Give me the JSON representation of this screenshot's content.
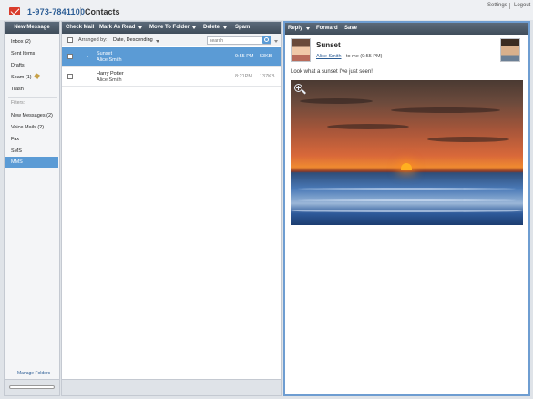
{
  "header": {
    "phone": "1-973-7841100",
    "contacts_label": "Contacts",
    "settings_label": "Settings",
    "logout_label": "Logout"
  },
  "sidebar": {
    "new_message_label": "New Message",
    "folders": [
      {
        "label": "Inbox (2)"
      },
      {
        "label": "Sent Items"
      },
      {
        "label": "Drafts"
      },
      {
        "label": "Spam (1)"
      },
      {
        "label": "Trash"
      }
    ],
    "filters_label": "Filters:",
    "filters": [
      {
        "label": "New Messages (2)"
      },
      {
        "label": "Voice Mails (2)"
      },
      {
        "label": "Fax"
      },
      {
        "label": "SMS"
      },
      {
        "label": "MMS",
        "active": true
      }
    ],
    "manage_folders_label": "Manage Folders"
  },
  "message_list": {
    "toolbar": {
      "check_mail": "Check Mail",
      "mark_as_read": "Mark As Read",
      "move_to_folder": "Move To Folder",
      "delete": "Delete",
      "spam": "Spam"
    },
    "arranged_by_label": "Arranged by:",
    "arranged_by_value": "Date, Descending",
    "search_placeholder": "search",
    "messages": [
      {
        "subject": "Sunset",
        "sender": "Alice Smith",
        "time": "9:55 PM",
        "size": "53KB",
        "selected": true
      },
      {
        "subject": "Harry Potter",
        "sender": "Alice Smith",
        "time": "8:21PM",
        "size": "137KB",
        "selected": false
      }
    ]
  },
  "reading_pane": {
    "toolbar": {
      "reply": "Reply",
      "forward": "Forward",
      "save": "Save"
    },
    "subject": "Sunset",
    "from": "Alice Smith",
    "to_text": "to me (9:55 PM)",
    "body": "Look what a sunset I've just seen!",
    "attachment": "sunset-photo",
    "zoom_icon": "zoom-in-icon"
  },
  "colors": {
    "accent": "#5b9bd5",
    "toolbar": "#4a5866",
    "brand": "#d93c2c",
    "link": "#2c5d95"
  }
}
